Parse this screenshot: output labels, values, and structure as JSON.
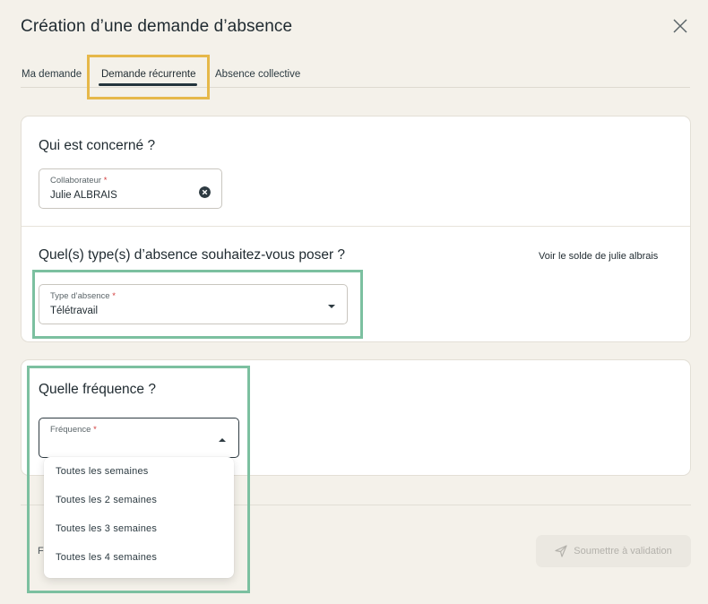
{
  "dialog": {
    "title": "Création d’une demande d’absence"
  },
  "tabs": [
    {
      "label": "Ma demande"
    },
    {
      "label": "Demande récurrente",
      "active": true
    },
    {
      "label": "Absence collective"
    }
  ],
  "concerned": {
    "title": "Qui est concerné ?",
    "collaborator_label": "Collaborateur",
    "required_mark": "*",
    "collaborator_value": "Julie ALBRAIS"
  },
  "absence_type": {
    "title": "Quel(s) type(s) d’absence souhaitez-vous poser ?",
    "balance_link": "Voir le solde de julie albrais",
    "field_label": "Type d’absence",
    "required_mark": "*",
    "value": "Télétravail"
  },
  "frequency": {
    "title": "Quelle fréquence ?",
    "field_label": "Fréquence",
    "required_mark": "*",
    "value": "",
    "options": [
      "Toutes les semaines",
      "Toutes les 2 semaines",
      "Toutes les 3 semaines",
      "Toutes les 4 semaines"
    ]
  },
  "footer": {
    "left_text": "Fe",
    "submit_label": "Soumettre à validation"
  },
  "colors": {
    "background": "#f4f1ea",
    "highlight_yellow": "#e6b84a",
    "highlight_green": "#7cc0a0",
    "accent_dark": "#24343c",
    "required": "#d23b3b"
  },
  "icons": {
    "close": "close-icon",
    "clear": "clear-circle-icon",
    "dropdown": "caret-down-icon",
    "dropdown_open": "caret-up-icon",
    "submit": "send-icon"
  }
}
